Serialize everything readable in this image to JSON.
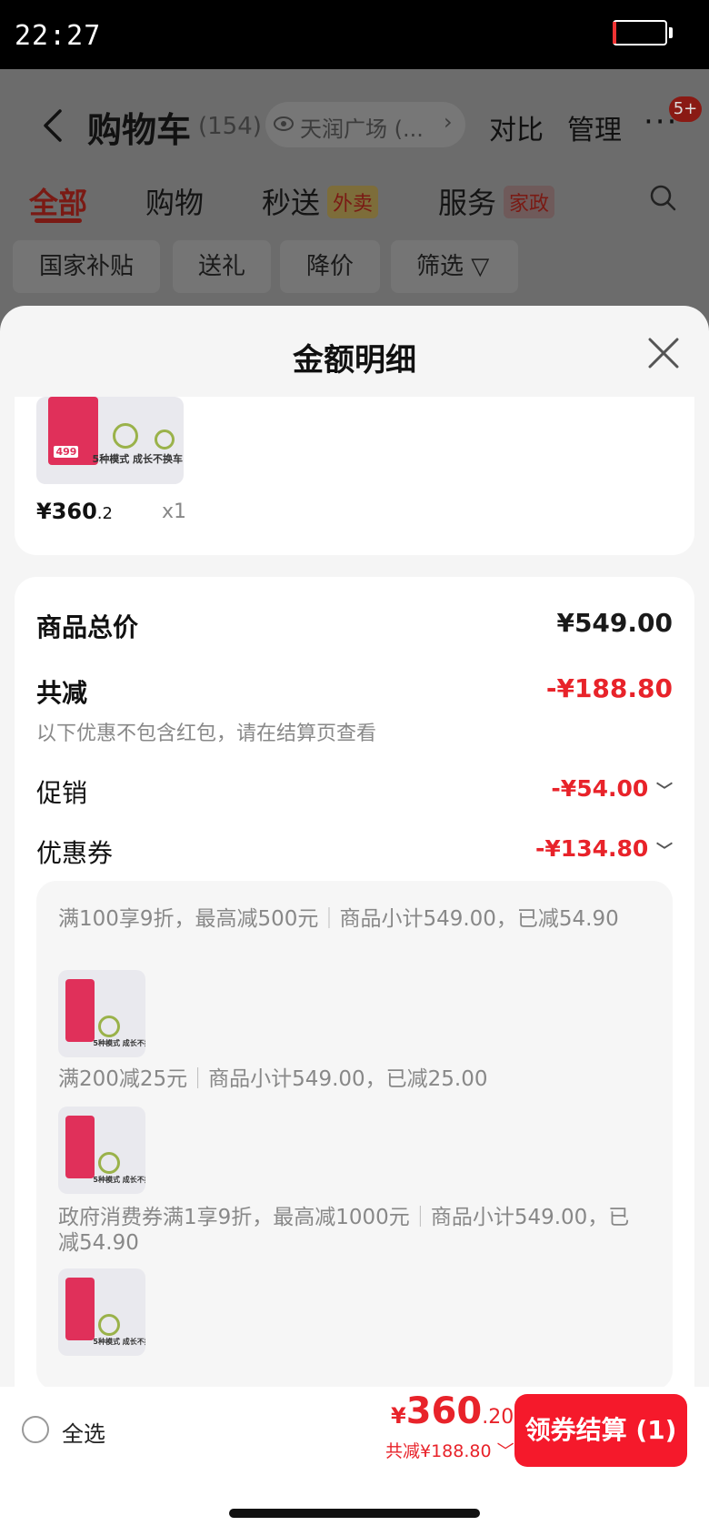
{
  "status_bar": {
    "time": "22:27"
  },
  "header": {
    "title": "购物车",
    "count": "(154)",
    "location": "天润广场 (...",
    "compare": "对比",
    "manage": "管理",
    "more": "···",
    "badge": "5+"
  },
  "tabs": [
    {
      "label": "全部"
    },
    {
      "label": "购物"
    },
    {
      "label": "秒送",
      "tag": "外卖"
    },
    {
      "label": "服务",
      "tag": "家政"
    }
  ],
  "chips": [
    "国家补贴",
    "送礼",
    "降价",
    "筛选"
  ],
  "sheet": {
    "title": "金额明细",
    "product": {
      "image_caption": "5种模式 成长不换车",
      "image_price": "499",
      "price_main": "¥360",
      "price_dec": ".2",
      "qty": "x1"
    },
    "summary": {
      "goods_total_label": "商品总价",
      "goods_total_value": "¥549.00",
      "total_discount_label": "共减",
      "total_discount_value": "-¥188.80",
      "note": "以下优惠不包含红包，请在结算页查看",
      "promo_label": "促销",
      "promo_value": "-¥54.00",
      "coupon_label": "优惠券",
      "coupon_value": "-¥134.80"
    },
    "coupons": [
      {
        "text": "满100享9折，最高减500元",
        "detail": "商品小计549.00，已减54.90"
      },
      {
        "text": "满200减25元",
        "detail": "商品小计549.00，已减25.00"
      },
      {
        "text": "政府消费券满1享9折，最高减1000元",
        "detail": "商品小计549.00，已减54.90"
      }
    ]
  },
  "bottom_bar": {
    "select_all": "全选",
    "total_currency": "¥",
    "total_int": "360",
    "total_dec": ".20",
    "total_discount": "共减¥188.80",
    "checkout": "领券结算 (1)"
  }
}
